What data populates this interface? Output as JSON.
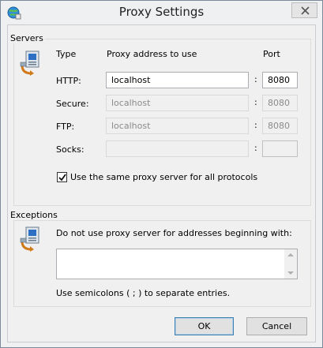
{
  "window": {
    "title": "Proxy Settings"
  },
  "servers": {
    "group_label": "Servers",
    "col_type": "Type",
    "col_address": "Proxy address to use",
    "col_port": "Port",
    "rows": [
      {
        "type": "HTTP:",
        "address": "localhost",
        "port": "8080",
        "enabled": true
      },
      {
        "type": "Secure:",
        "address": "localhost",
        "port": "8080",
        "enabled": false
      },
      {
        "type": "FTP:",
        "address": "localhost",
        "port": "8080",
        "enabled": false
      },
      {
        "type": "Socks:",
        "address": "",
        "port": "",
        "enabled": false
      }
    ],
    "same_proxy_label": "Use the same proxy server for all protocols",
    "same_proxy_checked": true
  },
  "exceptions": {
    "group_label": "Exceptions",
    "description": "Do not use proxy server for addresses beginning with:",
    "value": "",
    "hint": "Use semicolons ( ; ) to separate entries."
  },
  "buttons": {
    "ok": "OK",
    "cancel": "Cancel"
  }
}
